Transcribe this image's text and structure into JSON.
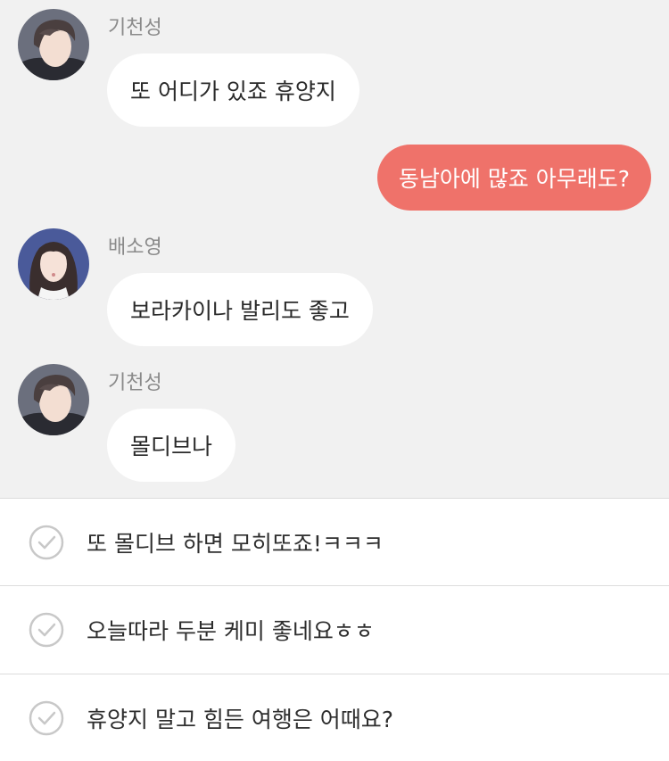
{
  "messages": [
    {
      "sender": "기천성",
      "text": "또 어디가 있죠 휴양지",
      "avatar": "male-avatar"
    },
    {
      "sender": "",
      "text": "동남아에 많죠 아무래도?",
      "avatar": ""
    },
    {
      "sender": "배소영",
      "text": "보라카이나 발리도 좋고",
      "avatar": "female-avatar"
    },
    {
      "sender": "기천성",
      "text": "몰디브나",
      "avatar": "male-avatar"
    }
  ],
  "replies": [
    {
      "text": "또 몰디브 하면 모히또죠!ㅋㅋㅋ",
      "icon": "check-circle-icon"
    },
    {
      "text": "오늘따라 두분 케미 좋네요ㅎㅎ",
      "icon": "check-circle-icon"
    },
    {
      "text": "휴양지 말고 힘든 여행은 어때요?",
      "icon": "check-circle-icon"
    }
  ],
  "colors": {
    "chat_background": "#f1f1f1",
    "my_bubble": "#ef726a",
    "their_bubble": "#ffffff",
    "sender_name": "#8a8a8a"
  }
}
